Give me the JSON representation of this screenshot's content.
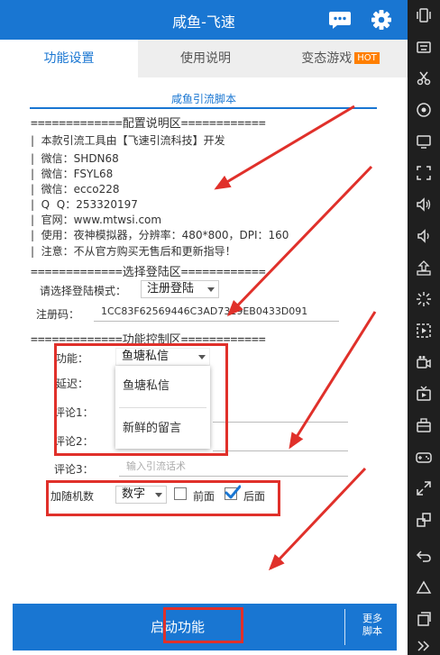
{
  "app": {
    "title": "咸鱼-飞速"
  },
  "tabs": [
    {
      "label": "功能设置"
    },
    {
      "label": "使用说明"
    },
    {
      "label": "变态游戏",
      "badge": "HOT"
    }
  ],
  "script_title": "咸鱼引流脚本",
  "config_header": "=============配置说明区============",
  "info_lines": [
    "|  本款引流工具由【飞速引流科技】开发",
    "|  微信：SHDN68",
    "|  微信：FSYL68",
    "|  微信：ecco228",
    "|  Q  Q：253320197",
    "|  官网：www.mtwsi.com",
    "|  使用：夜神模拟器，分辨率：480*800，DPI：160",
    "|  注意：不从官方购买无售后和更新指导！"
  ],
  "login_header": "=============选择登陆区============",
  "login": {
    "mode_label": "请选择登陆模式：",
    "mode_value": "注册登陆",
    "code_label": "注册码：",
    "code_value": "1CC83F62569446C3AD7319EB0433D091"
  },
  "control_header": "=============功能控制区============",
  "control": {
    "function_label": "功能：",
    "function_value": "鱼塘私信",
    "delay_label": "延迟：",
    "comment1_label": "评论1：",
    "comment2_label": "评论2：",
    "comment3_label": "评论3：",
    "comment3_placeholder": "输入引流话术",
    "dropdown_options": [
      "鱼塘私信",
      "新鲜的留言"
    ]
  },
  "random": {
    "label": "加随机数",
    "value": "数字",
    "front_label": "前面",
    "front_checked": false,
    "back_label": "后面",
    "back_checked": true
  },
  "bottom": {
    "start_label": "启动功能",
    "more_line1": "更多",
    "more_line2": "脚本"
  },
  "colors": {
    "primary": "#1976d2",
    "annotation_red": "#e0302a",
    "hot_badge": "#ff7f00",
    "toolbar_bg": "#1f1f1f"
  },
  "toolbar_icons": [
    "shake-phone-icon",
    "keyboard-icon",
    "scissors-icon",
    "location-icon",
    "screen-record-icon",
    "fullscreen-icon",
    "volume-up-icon",
    "volume-down-icon",
    "apk-install-icon",
    "loading-icon",
    "macro-icon",
    "video-recorder-icon",
    "multi-instance-icon",
    "toolbox-icon",
    "controller-icon",
    "zoom-icon",
    "multi-window-icon",
    "back-icon",
    "home-icon",
    "recents-icon",
    "expand-more-icon"
  ]
}
